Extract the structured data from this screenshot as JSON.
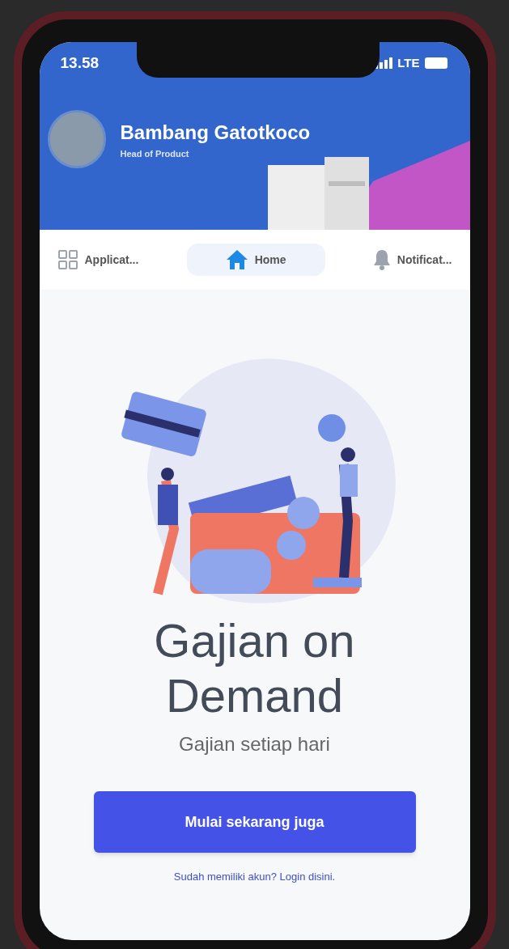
{
  "status_bar": {
    "time": "13.58",
    "network": "LTE"
  },
  "profile": {
    "name": "Bambang Gatotkoco",
    "role": "Head of Product"
  },
  "tabs": [
    {
      "label": "Applicat...",
      "kind": "grid",
      "selected": false
    },
    {
      "label": "Home",
      "kind": "home",
      "selected": true
    },
    {
      "label": "Notificat...",
      "kind": "bell",
      "selected": false
    }
  ],
  "hero": {
    "title": "Gajian on Demand",
    "subtitle": "Gajian setiap hari"
  },
  "primary_button": "Mulai sekarang juga",
  "login_link": "Sudah memiliki akun? Login disini."
}
